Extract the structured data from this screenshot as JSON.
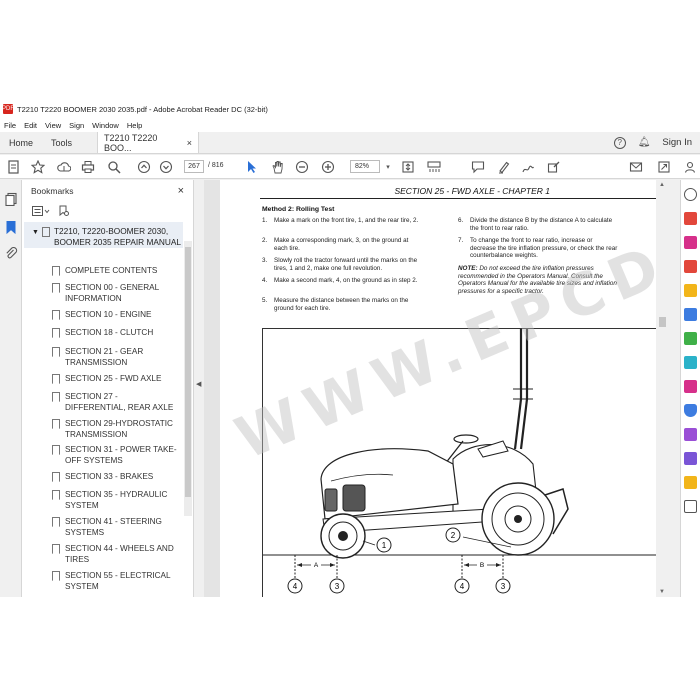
{
  "window": {
    "title": "T2210 T2220 BOOMER 2030 2035.pdf - Adobe Acrobat Reader DC (32-bit)",
    "pdf_badge": "PDF"
  },
  "menu": [
    "File",
    "Edit",
    "View",
    "Sign",
    "Window",
    "Help"
  ],
  "tabs": {
    "home": "Home",
    "tools": "Tools",
    "document": "T2210 T2220 BOO...",
    "close": "×",
    "help": "?",
    "sign_in": "Sign In"
  },
  "toolbar": {
    "page_current": "267",
    "page_total": "/ 816",
    "zoom": "82%"
  },
  "bookmarks": {
    "title": "Bookmarks",
    "close": "×",
    "root": "T2210, T2220-BOOMER 2030, BOOMER 2035 REPAIR MANUAL",
    "items": [
      "COMPLETE CONTENTS",
      "SECTION 00 - GENERAL INFORMATION",
      "SECTION 10 - ENGINE",
      "SECTION 18 - CLUTCH",
      "SECTION 21 - GEAR TRANSMISSION",
      "SECTION 25 - FWD AXLE",
      "SECTION 27 - DIFFERENTIAL, REAR AXLE",
      "SECTION 29-HYDROSTATIC TRANSMISSION",
      "SECTION 31 - POWER TAKE-OFF SYSTEMS",
      "SECTION 33 - BRAKES",
      "SECTION 35 - HYDRAULIC SYSTEM",
      "SECTION 41 - STEERING SYSTEMS",
      "SECTION 44 - WHEELS AND TIRES",
      "SECTION 55 - ELECTRICAL SYSTEM"
    ]
  },
  "page": {
    "section_title": "SECTION 25 - FWD AXLE - CHAPTER 1",
    "method_title": "Method 2: Rolling Test",
    "left_steps": [
      {
        "n": "1.",
        "text": "Make a mark on the front tire, 1, and the rear tire, 2."
      },
      {
        "n": "2.",
        "text": "Make a corresponding mark, 3, on the ground at each tire."
      },
      {
        "n": "3.",
        "text": "Slowly roll the tractor forward until the marks on the tires, 1 and 2, make one full revolution."
      },
      {
        "n": "4.",
        "text": "Make a second mark, 4, on the ground as in step 2."
      },
      {
        "n": "5.",
        "text": "Measure the distance between the marks on the ground for each tire."
      }
    ],
    "right_steps": [
      {
        "n": "6.",
        "text": "Divide the distance B by the distance A to calculate the front to rear ratio."
      },
      {
        "n": "7.",
        "text": "To change the front to rear ratio, increase or decrease the tire inflation pressure, or check the rear counterbalance weights."
      }
    ],
    "note_label": "NOTE:",
    "note_text": " Do not exceed the tire inflation pressures recommended in the Operators Manual. Consult the Operators Manual for the available tire sizes and inflation pressures for a specific tractor.",
    "callouts": {
      "c1": "1",
      "c2": "2",
      "c3a": "3",
      "c3b": "3",
      "c4a": "4",
      "c4b": "4",
      "dimA": "A",
      "dimB": "B"
    }
  },
  "watermark": "WWW.EPCDEPO.COM"
}
